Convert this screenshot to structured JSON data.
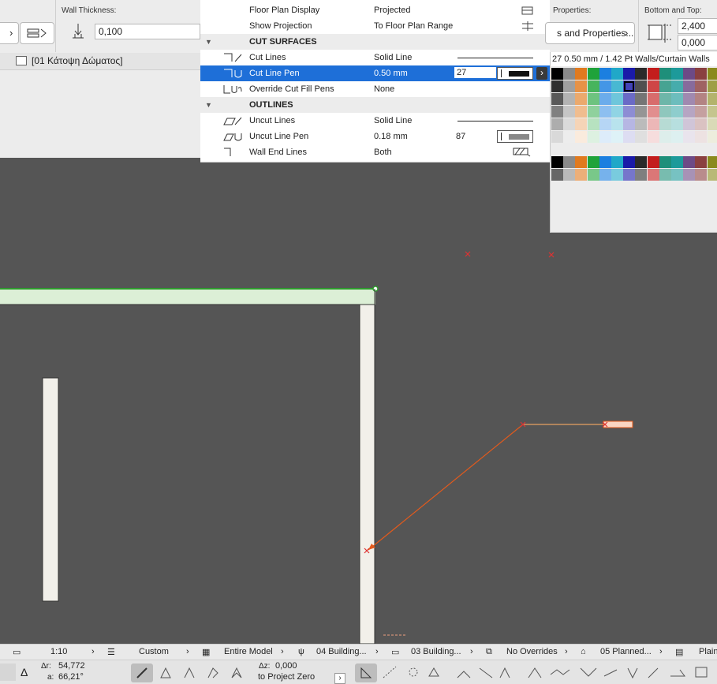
{
  "toolbar": {
    "wall_thickness_label": "Wall Thickness:",
    "wall_thickness_value": "0,100",
    "story_label": "[01 Κάτοψη Δώματος]"
  },
  "panel": {
    "rows": [
      {
        "name": "Floor Plan Display",
        "value": "Projected",
        "icon": "floor-plan-display-icon"
      },
      {
        "name": "Show Projection",
        "value": "To Floor Plan Range",
        "icon": "projection-range-icon"
      }
    ],
    "section_cut": "CUT SURFACES",
    "cut_rows": [
      {
        "name": "Cut Lines",
        "value": "Solid Line"
      },
      {
        "name": "Cut Line Pen",
        "value": "0.50 mm",
        "pen": "27"
      },
      {
        "name": "Override Cut Fill Pens",
        "value": "None"
      }
    ],
    "section_outlines": "OUTLINES",
    "outline_rows": [
      {
        "name": "Uncut Lines",
        "value": "Solid Line"
      },
      {
        "name": "Uncut Line Pen",
        "value": "0.18 mm",
        "pen": "87"
      },
      {
        "name": "Wall End Lines",
        "value": "Both"
      }
    ]
  },
  "palette": {
    "header": "27  0.50 mm /  1.42 Pt Walls/Curtain Walls"
  },
  "right_toolbar": {
    "properties_label": "Properties:",
    "properties_button": "s and Properties...",
    "bottom_top_label": "Bottom and Top:",
    "top_value": "2,400",
    "bottom_value": "0,000"
  },
  "status": {
    "scale": "1:10",
    "layer_combo": "Custom",
    "model_view": "Entire Model",
    "pen_set": "04 Building...",
    "model_view_option": "03 Building...",
    "overrides": "No Overrides",
    "renovation": "05 Planned...",
    "structure": "Plain"
  },
  "coords": {
    "dr_label": "Δr:",
    "dr_value": "54,772",
    "a_label": "a:",
    "a_value": "66,21°",
    "dz_label": "Δz:",
    "dz_value": "0,000",
    "ref_label": "to Project Zero"
  },
  "colors": {
    "selection": "#1e6fd8",
    "wall_green": "#2e9a2e",
    "trace_orange": "#e35a1c"
  }
}
